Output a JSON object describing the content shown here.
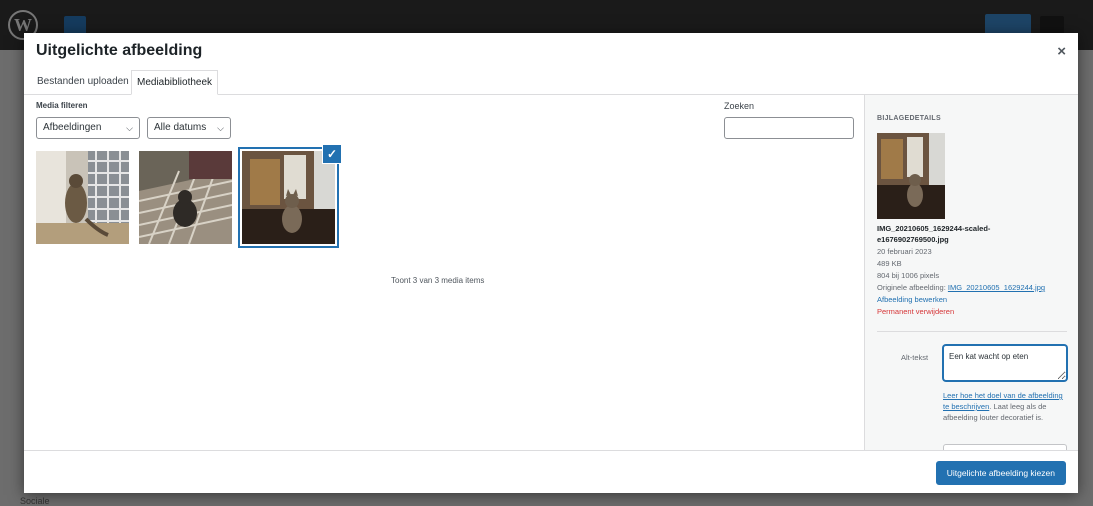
{
  "background": {
    "wp_logo": "W",
    "bottom_text": "Sociale"
  },
  "modal": {
    "title": "Uitgelichte afbeelding",
    "close_icon": "×"
  },
  "tabs": [
    {
      "label": "Bestanden uploaden",
      "active": false
    },
    {
      "label": "Mediabibliotheek",
      "active": true
    }
  ],
  "filters": {
    "label": "Media filteren",
    "type_select": "Afbeeldingen",
    "date_select": "Alle datums"
  },
  "search": {
    "label": "Zoeken",
    "value": ""
  },
  "media_items": [
    {
      "icon": "cat-photo-1",
      "selected": false
    },
    {
      "icon": "cat-photo-2",
      "selected": false
    },
    {
      "icon": "cat-photo-3",
      "selected": true
    }
  ],
  "check_icon": "✓",
  "count_text": "Toont 3 van 3 media items",
  "details": {
    "heading": "BIJLAGEDETAILS",
    "filename_1": "IMG_20210605_1629244-scaled-",
    "filename_2": "e1676902769500.jpg",
    "date": "20 februari 2023",
    "size": "489 KB",
    "dimensions": "804 bij 1006 pixels",
    "original_label": "Originele afbeelding: ",
    "original_link": "IMG_20210605_1629244.jpg",
    "edit_link": "Afbeelding bewerken",
    "delete_link": "Permanent verwijderen",
    "alt_label": "Alt-tekst",
    "alt_value": "Een kat wacht op eten",
    "alt_help_link": "Leer hoe het doel van de afbeelding te beschrijven",
    "alt_help_text": ". Laat leeg als de afbeelding louter decoratief is."
  },
  "footer": {
    "primary_button": "Uitgelichte afbeelding kiezen"
  },
  "colors": {
    "accent": "#2271b1",
    "danger": "#d63638"
  }
}
